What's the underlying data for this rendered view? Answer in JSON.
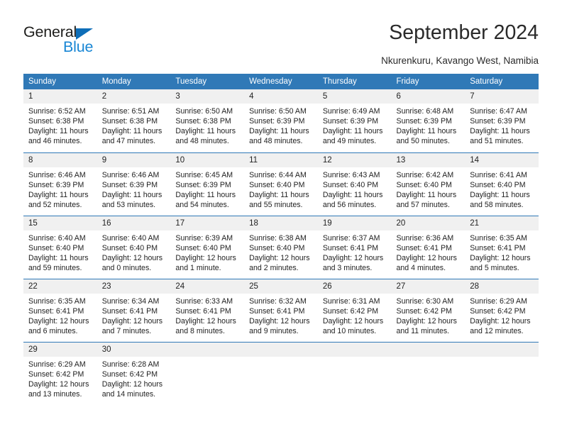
{
  "brand": {
    "name_dark": "General",
    "name_light": "Blue",
    "triangle_color": "#0e6eb8",
    "accent_color": "#1886d4"
  },
  "header": {
    "title": "September 2024",
    "location": "Nkurenkuru, Kavango West, Namibia"
  },
  "calendar": {
    "header_bg": "#3079b7",
    "daynum_bg": "#f0f0f0",
    "weekday_headers": [
      "Sunday",
      "Monday",
      "Tuesday",
      "Wednesday",
      "Thursday",
      "Friday",
      "Saturday"
    ],
    "weeks": [
      [
        {
          "day": "1",
          "sunrise": "Sunrise: 6:52 AM",
          "sunset": "Sunset: 6:38 PM",
          "daylight": "Daylight: 11 hours and 46 minutes."
        },
        {
          "day": "2",
          "sunrise": "Sunrise: 6:51 AM",
          "sunset": "Sunset: 6:38 PM",
          "daylight": "Daylight: 11 hours and 47 minutes."
        },
        {
          "day": "3",
          "sunrise": "Sunrise: 6:50 AM",
          "sunset": "Sunset: 6:38 PM",
          "daylight": "Daylight: 11 hours and 48 minutes."
        },
        {
          "day": "4",
          "sunrise": "Sunrise: 6:50 AM",
          "sunset": "Sunset: 6:39 PM",
          "daylight": "Daylight: 11 hours and 48 minutes."
        },
        {
          "day": "5",
          "sunrise": "Sunrise: 6:49 AM",
          "sunset": "Sunset: 6:39 PM",
          "daylight": "Daylight: 11 hours and 49 minutes."
        },
        {
          "day": "6",
          "sunrise": "Sunrise: 6:48 AM",
          "sunset": "Sunset: 6:39 PM",
          "daylight": "Daylight: 11 hours and 50 minutes."
        },
        {
          "day": "7",
          "sunrise": "Sunrise: 6:47 AM",
          "sunset": "Sunset: 6:39 PM",
          "daylight": "Daylight: 11 hours and 51 minutes."
        }
      ],
      [
        {
          "day": "8",
          "sunrise": "Sunrise: 6:46 AM",
          "sunset": "Sunset: 6:39 PM",
          "daylight": "Daylight: 11 hours and 52 minutes."
        },
        {
          "day": "9",
          "sunrise": "Sunrise: 6:46 AM",
          "sunset": "Sunset: 6:39 PM",
          "daylight": "Daylight: 11 hours and 53 minutes."
        },
        {
          "day": "10",
          "sunrise": "Sunrise: 6:45 AM",
          "sunset": "Sunset: 6:39 PM",
          "daylight": "Daylight: 11 hours and 54 minutes."
        },
        {
          "day": "11",
          "sunrise": "Sunrise: 6:44 AM",
          "sunset": "Sunset: 6:40 PM",
          "daylight": "Daylight: 11 hours and 55 minutes."
        },
        {
          "day": "12",
          "sunrise": "Sunrise: 6:43 AM",
          "sunset": "Sunset: 6:40 PM",
          "daylight": "Daylight: 11 hours and 56 minutes."
        },
        {
          "day": "13",
          "sunrise": "Sunrise: 6:42 AM",
          "sunset": "Sunset: 6:40 PM",
          "daylight": "Daylight: 11 hours and 57 minutes."
        },
        {
          "day": "14",
          "sunrise": "Sunrise: 6:41 AM",
          "sunset": "Sunset: 6:40 PM",
          "daylight": "Daylight: 11 hours and 58 minutes."
        }
      ],
      [
        {
          "day": "15",
          "sunrise": "Sunrise: 6:40 AM",
          "sunset": "Sunset: 6:40 PM",
          "daylight": "Daylight: 11 hours and 59 minutes."
        },
        {
          "day": "16",
          "sunrise": "Sunrise: 6:40 AM",
          "sunset": "Sunset: 6:40 PM",
          "daylight": "Daylight: 12 hours and 0 minutes."
        },
        {
          "day": "17",
          "sunrise": "Sunrise: 6:39 AM",
          "sunset": "Sunset: 6:40 PM",
          "daylight": "Daylight: 12 hours and 1 minute."
        },
        {
          "day": "18",
          "sunrise": "Sunrise: 6:38 AM",
          "sunset": "Sunset: 6:40 PM",
          "daylight": "Daylight: 12 hours and 2 minutes."
        },
        {
          "day": "19",
          "sunrise": "Sunrise: 6:37 AM",
          "sunset": "Sunset: 6:41 PM",
          "daylight": "Daylight: 12 hours and 3 minutes."
        },
        {
          "day": "20",
          "sunrise": "Sunrise: 6:36 AM",
          "sunset": "Sunset: 6:41 PM",
          "daylight": "Daylight: 12 hours and 4 minutes."
        },
        {
          "day": "21",
          "sunrise": "Sunrise: 6:35 AM",
          "sunset": "Sunset: 6:41 PM",
          "daylight": "Daylight: 12 hours and 5 minutes."
        }
      ],
      [
        {
          "day": "22",
          "sunrise": "Sunrise: 6:35 AM",
          "sunset": "Sunset: 6:41 PM",
          "daylight": "Daylight: 12 hours and 6 minutes."
        },
        {
          "day": "23",
          "sunrise": "Sunrise: 6:34 AM",
          "sunset": "Sunset: 6:41 PM",
          "daylight": "Daylight: 12 hours and 7 minutes."
        },
        {
          "day": "24",
          "sunrise": "Sunrise: 6:33 AM",
          "sunset": "Sunset: 6:41 PM",
          "daylight": "Daylight: 12 hours and 8 minutes."
        },
        {
          "day": "25",
          "sunrise": "Sunrise: 6:32 AM",
          "sunset": "Sunset: 6:41 PM",
          "daylight": "Daylight: 12 hours and 9 minutes."
        },
        {
          "day": "26",
          "sunrise": "Sunrise: 6:31 AM",
          "sunset": "Sunset: 6:42 PM",
          "daylight": "Daylight: 12 hours and 10 minutes."
        },
        {
          "day": "27",
          "sunrise": "Sunrise: 6:30 AM",
          "sunset": "Sunset: 6:42 PM",
          "daylight": "Daylight: 12 hours and 11 minutes."
        },
        {
          "day": "28",
          "sunrise": "Sunrise: 6:29 AM",
          "sunset": "Sunset: 6:42 PM",
          "daylight": "Daylight: 12 hours and 12 minutes."
        }
      ],
      [
        {
          "day": "29",
          "sunrise": "Sunrise: 6:29 AM",
          "sunset": "Sunset: 6:42 PM",
          "daylight": "Daylight: 12 hours and 13 minutes."
        },
        {
          "day": "30",
          "sunrise": "Sunrise: 6:28 AM",
          "sunset": "Sunset: 6:42 PM",
          "daylight": "Daylight: 12 hours and 14 minutes."
        },
        {
          "day": "",
          "sunrise": "",
          "sunset": "",
          "daylight": ""
        },
        {
          "day": "",
          "sunrise": "",
          "sunset": "",
          "daylight": ""
        },
        {
          "day": "",
          "sunrise": "",
          "sunset": "",
          "daylight": ""
        },
        {
          "day": "",
          "sunrise": "",
          "sunset": "",
          "daylight": ""
        },
        {
          "day": "",
          "sunrise": "",
          "sunset": "",
          "daylight": ""
        }
      ]
    ]
  }
}
